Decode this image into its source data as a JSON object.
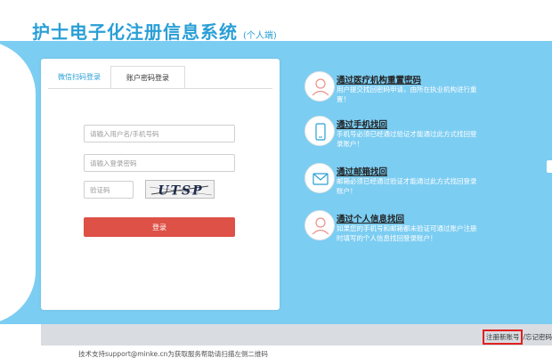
{
  "header": {
    "title": "护士电子化注册信息系统",
    "subtitle": "(个人端)"
  },
  "login": {
    "tabs": [
      {
        "label": "微信扫码登录"
      },
      {
        "label": "账户密码登录"
      }
    ],
    "username_placeholder": "请输入用户名/手机号码",
    "password_placeholder": "请输入登录密码",
    "captcha_placeholder": "验证码",
    "captcha_text": "UTSP",
    "submit_label": "登录"
  },
  "options": [
    {
      "icon": "person-icon",
      "title": "通过医疗机构重置密码",
      "desc": "用户提交找回密码申请，由所在执业机构进行重置！"
    },
    {
      "icon": "phone-icon",
      "title": "通过手机找回",
      "desc": "手机号必须已经通过验证才能通过此方式找回登录账户！"
    },
    {
      "icon": "mail-icon",
      "title": "通过邮箱找回",
      "desc": "邮箱必须已经通过验证才能通过此方式找回登录账户！"
    },
    {
      "icon": "person-icon",
      "title": "通过个人信息找回",
      "desc": "如果您的手机号和邮箱都未验证可通过账户注册时填写的个人信息找回登录账户！"
    }
  ],
  "bottom": {
    "register_label": "注册新账号",
    "separator": "/",
    "forgot_label": "忘记密码"
  },
  "footer": {
    "text": "技术支持support@minke.cn为获取服务帮助请扫描左侧二维码"
  },
  "colors": {
    "brand": "#2a9fd6",
    "banner": "#7ccdf2",
    "button": "#dd5146",
    "highlight": "#e02020"
  }
}
